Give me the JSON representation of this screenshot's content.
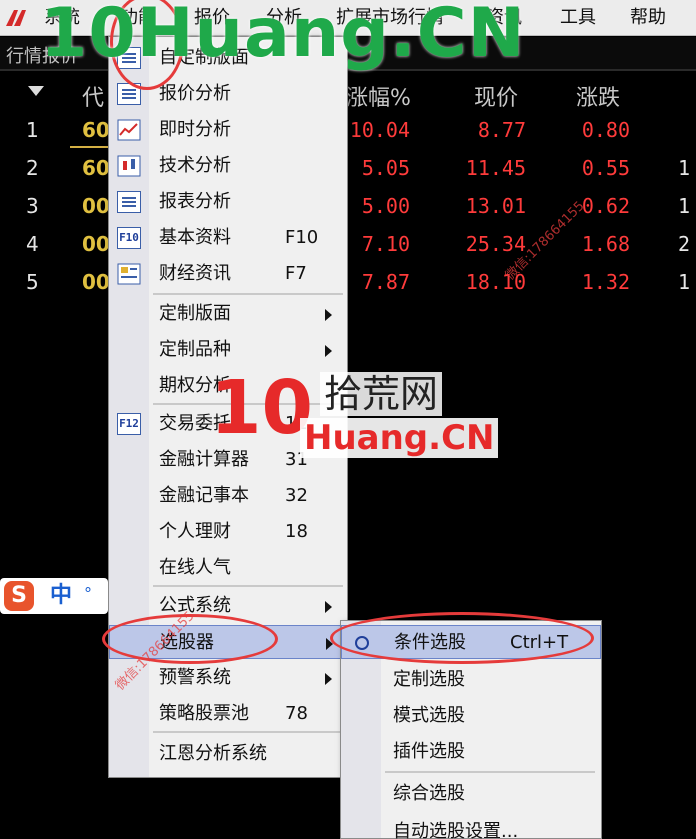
{
  "menubar": {
    "items": [
      "系统",
      "功能",
      "报价",
      "分析",
      "扩展市场行情",
      "资讯",
      "工具",
      "帮助"
    ]
  },
  "toolstrip": {
    "label": "行情报价"
  },
  "table": {
    "headers": [
      "代",
      "涨幅%",
      "现价",
      "涨跌"
    ],
    "rows": [
      {
        "num": "1",
        "code": "60",
        "pct": "10.04",
        "price": "8.77",
        "chg": "0.80",
        "extra": ""
      },
      {
        "num": "2",
        "code": "60",
        "pct": "5.05",
        "price": "11.45",
        "chg": "0.55",
        "extra": "1"
      },
      {
        "num": "3",
        "code": "00",
        "pct": "5.00",
        "price": "13.01",
        "chg": "0.62",
        "extra": "1"
      },
      {
        "num": "4",
        "code": "00",
        "pct": "7.10",
        "price": "25.34",
        "chg": "1.68",
        "extra": "2"
      },
      {
        "num": "5",
        "code": "00",
        "pct": "7.87",
        "price": "18.10",
        "chg": "1.32",
        "extra": "1"
      }
    ]
  },
  "menu": {
    "items": [
      {
        "label": "自定制版面",
        "key": "",
        "icon": "layout-icon"
      },
      {
        "label": "报价分析",
        "key": "",
        "icon": "quote-icon"
      },
      {
        "label": "即时分析",
        "key": "",
        "icon": "chart-line-icon"
      },
      {
        "label": "技术分析",
        "key": "",
        "icon": "candlestick-icon"
      },
      {
        "label": "报表分析",
        "key": "",
        "icon": "report-icon"
      },
      {
        "label": "基本资料",
        "key": "F10",
        "icon": "f10-icon",
        "icon_text": "F10"
      },
      {
        "label": "财经资讯",
        "key": "F7",
        "icon": "news-icon"
      },
      {
        "label": "定制版面",
        "key": "",
        "submenu": true
      },
      {
        "label": "定制品种",
        "key": "",
        "submenu": true
      },
      {
        "label": "期权分析",
        "key": ""
      },
      {
        "label": "交易委托",
        "key": "12",
        "icon": "f12-icon",
        "icon_text": "F12"
      },
      {
        "label": "金融计算器",
        "key": "31"
      },
      {
        "label": "金融记事本",
        "key": "32"
      },
      {
        "label": "个人理财",
        "key": "18"
      },
      {
        "label": "在线人气",
        "key": ""
      },
      {
        "label": "公式系统",
        "key": "",
        "submenu": true
      },
      {
        "label": "选股器",
        "key": "",
        "submenu": true,
        "highlighted": true
      },
      {
        "label": "预警系统",
        "key": "",
        "submenu": true
      },
      {
        "label": "策略股票池",
        "key": "78"
      },
      {
        "label": "江恩分析系统",
        "key": ""
      }
    ]
  },
  "submenu": {
    "items": [
      {
        "label": "条件选股",
        "key": "Ctrl+T",
        "highlighted": true,
        "icon": "circle-icon"
      },
      {
        "label": "定制选股",
        "key": ""
      },
      {
        "label": "模式选股",
        "key": ""
      },
      {
        "label": "插件选股",
        "key": ""
      },
      {
        "label": "综合选股",
        "key": ""
      },
      {
        "label": "自动选股设置...",
        "key": ""
      }
    ]
  },
  "watermark": {
    "top": "10Huang.CN",
    "center_num": "10",
    "center_cn": "拾荒网",
    "center_domain": "Huang.CN",
    "ime_s": "S",
    "ime_cn": "中",
    "ime_dot": "°",
    "diag": "微信:178664155"
  },
  "colors": {
    "up": "#ff3b3b",
    "code": "#e0c040",
    "highlight": "#bcc7e8",
    "annotation": "#e53b3b",
    "watermark_green": "#1fa94a"
  }
}
